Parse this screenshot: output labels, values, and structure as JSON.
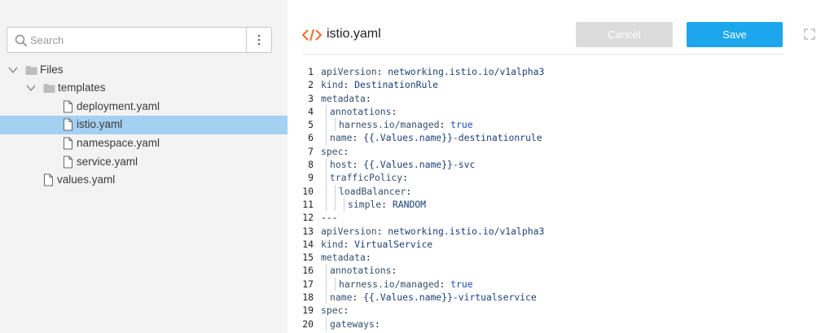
{
  "sidebar": {
    "search_placeholder": "Search",
    "more_icon": "kebab-vertical-icon",
    "tree": [
      {
        "label": "Files",
        "type": "folder",
        "level": 0,
        "expanded": true,
        "selected": false
      },
      {
        "label": "templates",
        "type": "folder",
        "level": 1,
        "expanded": true,
        "selected": false
      },
      {
        "label": "deployment.yaml",
        "type": "file",
        "level": 2,
        "selected": false
      },
      {
        "label": "istio.yaml",
        "type": "file",
        "level": 2,
        "selected": true
      },
      {
        "label": "namespace.yaml",
        "type": "file",
        "level": 2,
        "selected": false
      },
      {
        "label": "service.yaml",
        "type": "file",
        "level": 2,
        "selected": false
      },
      {
        "label": "values.yaml",
        "type": "file",
        "level": 1,
        "selected": false
      }
    ]
  },
  "editor": {
    "title": "istio.yaml",
    "title_icon": "code-tag-icon",
    "cancel_label": "Cancel",
    "save_label": "Save",
    "expand_icon": "expand-icon",
    "accent_color": "#f26b21",
    "save_color": "#1ca7ec",
    "lines": [
      {
        "n": "1",
        "key": "apiVersion",
        "val": "networking.istio.io/v1alpha3",
        "depth": 0
      },
      {
        "n": "2",
        "key": "kind",
        "val": "DestinationRule",
        "depth": 0
      },
      {
        "n": "3",
        "key": "metadata",
        "val": "",
        "depth": 0
      },
      {
        "n": "4",
        "key": "annotations",
        "val": "",
        "depth": 1
      },
      {
        "n": "5",
        "key": "harness.io/managed",
        "val": "true",
        "depth": 2,
        "bool": true
      },
      {
        "n": "6",
        "key": "name",
        "val": "{{.Values.name}}-destinationrule",
        "depth": 1
      },
      {
        "n": "7",
        "key": "spec",
        "val": "",
        "depth": 0
      },
      {
        "n": "8",
        "key": "host",
        "val": "{{.Values.name}}-svc",
        "depth": 1
      },
      {
        "n": "9",
        "key": "trafficPolicy",
        "val": "",
        "depth": 1
      },
      {
        "n": "10",
        "key": "loadBalancer",
        "val": "",
        "depth": 2
      },
      {
        "n": "11",
        "key": "simple",
        "val": "RANDOM",
        "depth": 3
      },
      {
        "n": "12",
        "raw": "---",
        "depth": 0
      },
      {
        "n": "13",
        "key": "apiVersion",
        "val": "networking.istio.io/v1alpha3",
        "depth": 0
      },
      {
        "n": "14",
        "key": "kind",
        "val": "VirtualService",
        "depth": 0
      },
      {
        "n": "15",
        "key": "metadata",
        "val": "",
        "depth": 0
      },
      {
        "n": "16",
        "key": "annotations",
        "val": "",
        "depth": 1
      },
      {
        "n": "17",
        "key": "harness.io/managed",
        "val": "true",
        "depth": 2,
        "bool": true
      },
      {
        "n": "18",
        "key": "name",
        "val": "{{.Values.name}}-virtualservice",
        "depth": 1
      },
      {
        "n": "19",
        "key": "spec",
        "val": "",
        "depth": 0
      },
      {
        "n": "20",
        "key": "gateways",
        "val": "",
        "depth": 1
      }
    ]
  }
}
